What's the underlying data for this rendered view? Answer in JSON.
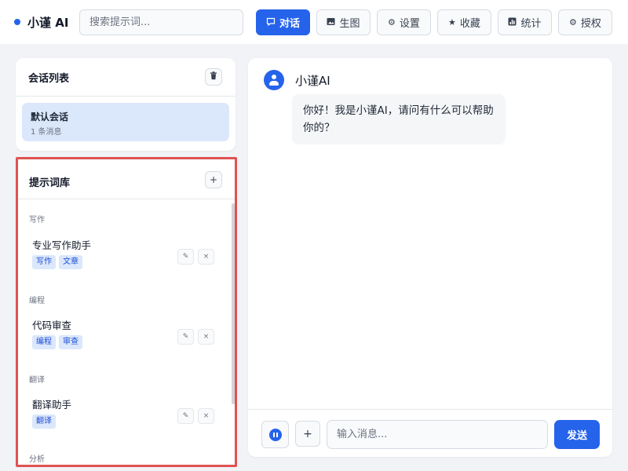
{
  "app": {
    "brand": "小谨 AI"
  },
  "header": {
    "search_placeholder": "搜索提示词...",
    "nav": [
      {
        "label": "对话",
        "icon": "chat-icon",
        "active": true
      },
      {
        "label": "生图",
        "icon": "image-icon",
        "active": false
      },
      {
        "label": "设置",
        "icon": "gear-icon",
        "active": false
      },
      {
        "label": "收藏",
        "icon": "star-icon",
        "active": false
      },
      {
        "label": "统计",
        "icon": "chart-icon",
        "active": false
      },
      {
        "label": "授权",
        "icon": "gear-icon",
        "active": false
      }
    ]
  },
  "conversations": {
    "title": "会话列表",
    "items": [
      {
        "title": "默认会话",
        "subtitle": "1 条消息",
        "active": true
      }
    ]
  },
  "prompts": {
    "title": "提示词库",
    "categories": [
      {
        "name": "写作",
        "items": [
          {
            "title": "专业写作助手",
            "tags": [
              "写作",
              "文章"
            ]
          }
        ]
      },
      {
        "name": "编程",
        "items": [
          {
            "title": "代码审查",
            "tags": [
              "编程",
              "审查"
            ]
          }
        ]
      },
      {
        "name": "翻译",
        "items": [
          {
            "title": "翻译助手",
            "tags": [
              "翻译"
            ]
          }
        ]
      },
      {
        "name": "分析",
        "items": []
      }
    ]
  },
  "chat": {
    "bot_name": "小谨AI",
    "messages": [
      {
        "role": "assistant",
        "text": "你好！我是小谨AI，请问有什么可以帮助你的？"
      }
    ],
    "input_placeholder": "输入消息...",
    "send_label": "发送"
  },
  "colors": {
    "accent": "#2563eb",
    "highlight_border": "#e05252",
    "tag_bg": "#dbe7fb"
  }
}
